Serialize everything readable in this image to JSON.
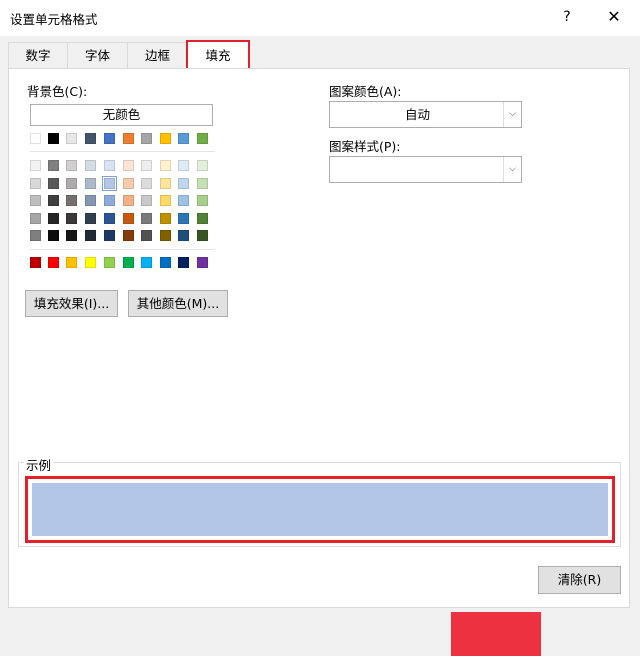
{
  "window": {
    "title": "设置单元格格式",
    "help": "?",
    "close": "✕"
  },
  "tabs": [
    {
      "label": "数字"
    },
    {
      "label": "字体"
    },
    {
      "label": "边框"
    },
    {
      "label": "填充",
      "active": true
    }
  ],
  "fill": {
    "bg_label": "背景色(C):",
    "no_color": "无颜色",
    "fill_effects": "填充效果(I)...",
    "more_colors": "其他颜色(M)...",
    "pattern_color_label": "图案颜色(A):",
    "pattern_color_value": "自动",
    "pattern_style_label": "图案样式(P):",
    "pattern_style_value": ""
  },
  "palette": {
    "theme_row": [
      "#ffffff",
      "#000000",
      "#e7e6e6",
      "#44546a",
      "#4472c4",
      "#ed7d31",
      "#a5a5a5",
      "#ffc000",
      "#5b9bd5",
      "#70ad47"
    ],
    "shades": [
      [
        "#f2f2f2",
        "#7f7f7f",
        "#d0cece",
        "#d6dce4",
        "#d9e2f3",
        "#fbe5d5",
        "#ededed",
        "#fff2cc",
        "#deebf6",
        "#e2efd9"
      ],
      [
        "#d8d8d8",
        "#595959",
        "#aeabab",
        "#adb9ca",
        "#b4c6e7",
        "#f7cbac",
        "#dbdbdb",
        "#fee599",
        "#bdd7ee",
        "#c5e0b3"
      ],
      [
        "#bfbfbf",
        "#3f3f3f",
        "#757070",
        "#8496b0",
        "#8eaadb",
        "#f4b183",
        "#c9c9c9",
        "#ffd965",
        "#9cc3e5",
        "#a8d08d"
      ],
      [
        "#a5a5a5",
        "#262626",
        "#3a3838",
        "#323f4f",
        "#2f5496",
        "#c55a11",
        "#7b7b7b",
        "#bf9000",
        "#2e75b5",
        "#538135"
      ],
      [
        "#7f7f7f",
        "#0c0c0c",
        "#171616",
        "#222a35",
        "#1f3864",
        "#833c0b",
        "#525252",
        "#7f6000",
        "#1e4e79",
        "#375623"
      ]
    ],
    "standard_row": [
      "#c00000",
      "#ff0000",
      "#ffc000",
      "#ffff00",
      "#92d050",
      "#00b050",
      "#00b0f0",
      "#0070c0",
      "#002060",
      "#7030a0"
    ],
    "selected": "#b4c6e7"
  },
  "sample": {
    "label": "示例",
    "color": "#b4c6e7"
  },
  "buttons": {
    "clear": "清除(R)"
  },
  "accent": "#e0202a"
}
